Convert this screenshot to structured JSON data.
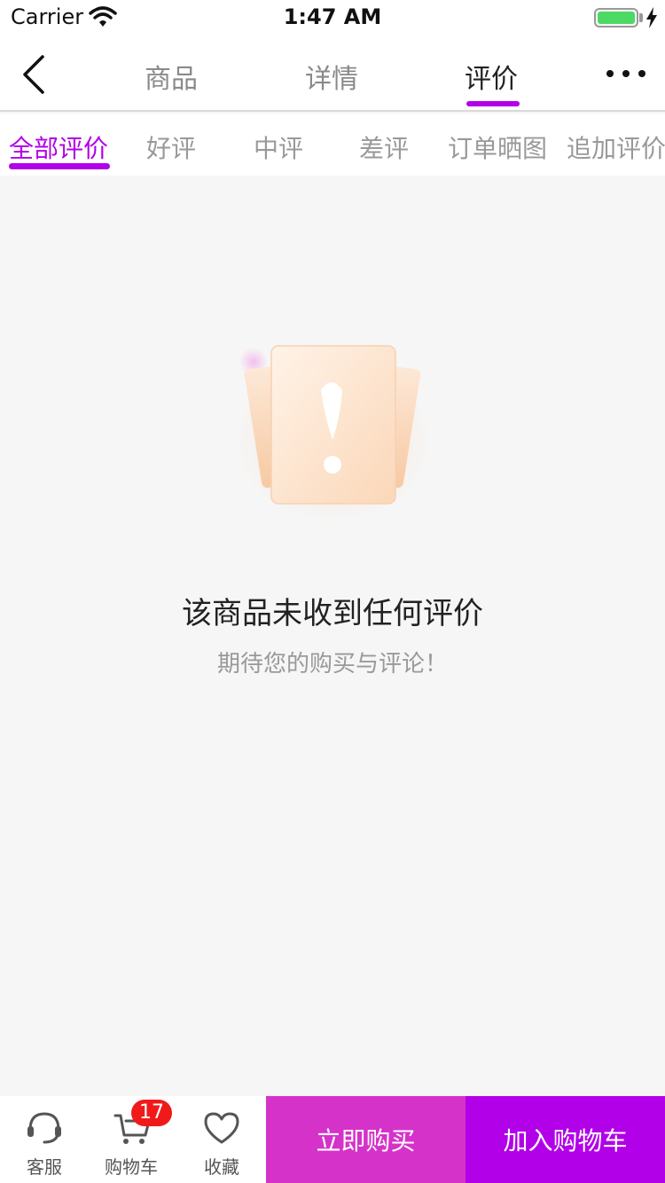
{
  "status_bar": {
    "carrier": "Carrier",
    "time": "1:47 AM",
    "battery_color": "#4cd964"
  },
  "nav": {
    "tabs": [
      {
        "label": "商品"
      },
      {
        "label": "详情"
      },
      {
        "label": "评价",
        "active": true
      }
    ],
    "back_icon": "chevron-left-icon",
    "more_icon": "more-icon",
    "accent_color": "#b200e8"
  },
  "filter_tabs": [
    {
      "label": "全部评价",
      "active": true
    },
    {
      "label": "好评"
    },
    {
      "label": "中评"
    },
    {
      "label": "差评"
    },
    {
      "label": "订单晒图"
    },
    {
      "label": "追加评价"
    }
  ],
  "empty_state": {
    "icon": "exclamation-card-icon",
    "title": "该商品未收到任何评价",
    "subtitle": "期待您的购买与评论！"
  },
  "bottom_bar": {
    "items": [
      {
        "label": "客服",
        "icon": "customer-service-icon"
      },
      {
        "label": "购物车",
        "icon": "cart-icon",
        "badge": "17"
      },
      {
        "label": "收藏",
        "icon": "heart-icon"
      }
    ],
    "buy_now_label": "立即购买",
    "add_to_cart_label": "加入购物车",
    "buy_now_color": "#d532c9",
    "add_to_cart_color": "#b200e8"
  }
}
